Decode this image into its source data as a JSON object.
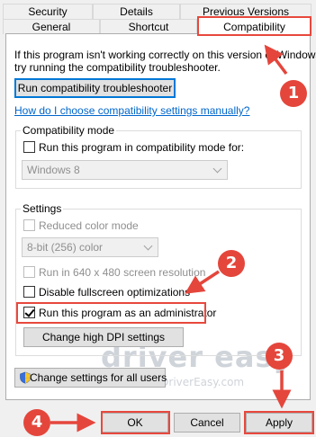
{
  "tabs": {
    "row1": [
      "Security",
      "Details",
      "Previous Versions"
    ],
    "row2": [
      "General",
      "Shortcut",
      "Compatibility"
    ],
    "active": "Compatibility"
  },
  "intro": {
    "line1": "If this program isn't working correctly on this version of Windows,",
    "line2": "try running the compatibility troubleshooter."
  },
  "troubleshooter_button": "Run compatibility troubleshooter",
  "help_link": "How do I choose compatibility settings manually?",
  "compat_mode": {
    "group_label": "Compatibility mode",
    "checkbox_label": "Run this program in compatibility mode for:",
    "checked": false,
    "selected_os": "Windows 8"
  },
  "settings": {
    "group_label": "Settings",
    "reduced_color_label": "Reduced color mode",
    "color_value": "8-bit (256) color",
    "resolution_label": "Run in 640 x 480 screen resolution",
    "disable_fullscreen_label": "Disable fullscreen optimizations",
    "run_as_admin_label": "Run this program as an administrator",
    "run_as_admin_checked": true,
    "high_dpi_button": "Change high DPI settings"
  },
  "all_users_button": "Change settings for all users",
  "footer": {
    "ok": "OK",
    "cancel": "Cancel",
    "apply": "Apply"
  },
  "watermark": {
    "brand": "driver easy",
    "url": "www.DriverEasy.com"
  },
  "markers": [
    "1",
    "2",
    "3",
    "4"
  ],
  "colors": {
    "annotation_red": "#e4463c",
    "link_blue": "#0066cc",
    "focus_blue": "#0078d7"
  }
}
